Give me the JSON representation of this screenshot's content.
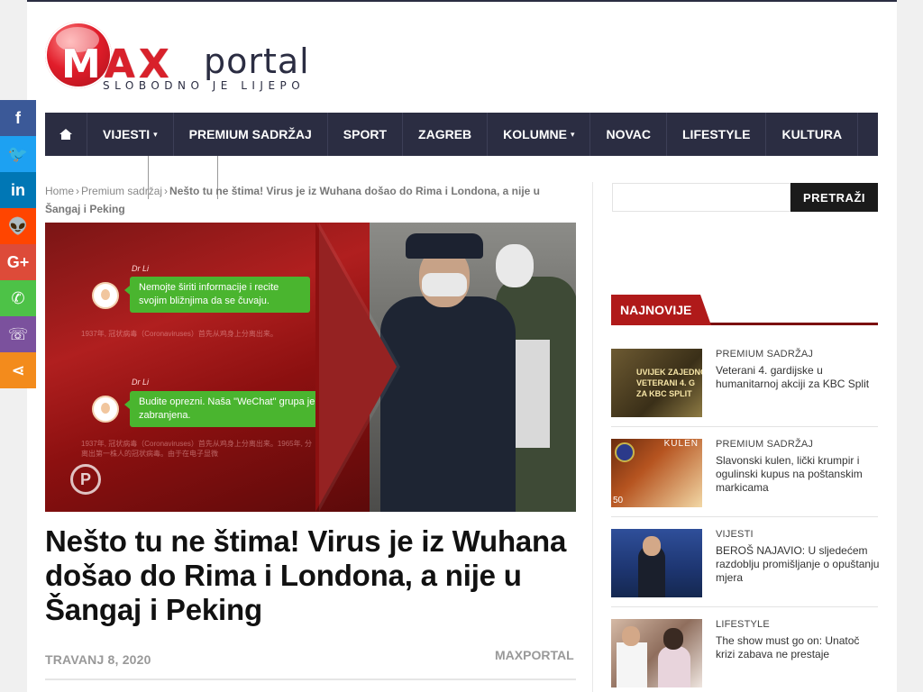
{
  "logo": {
    "max_first": "M",
    "max_rest": "AX",
    "portal": "portal",
    "slogan": "SLOBODNO JE LIJEPO"
  },
  "nav": {
    "items": [
      {
        "label": "VIJESTI",
        "dropdown": true
      },
      {
        "label": "PREMIUM SADRŽAJ",
        "dropdown": false
      },
      {
        "label": "SPORT",
        "dropdown": false
      },
      {
        "label": "ZAGREB",
        "dropdown": false
      },
      {
        "label": "KOLUMNE",
        "dropdown": true
      },
      {
        "label": "NOVAC",
        "dropdown": false
      },
      {
        "label": "LIFESTYLE",
        "dropdown": false
      },
      {
        "label": "KULTURA",
        "dropdown": false
      }
    ],
    "chevron": "▾"
  },
  "breadcrumb": {
    "home": "Home",
    "sep": "›",
    "category": "Premium sadržaj",
    "current": "Nešto tu ne štima! Virus je iz Wuhana došao do Rima i Londona, a nije u Šangaj i Peking"
  },
  "feature": {
    "chat_name_1": "Dr Li",
    "chat_name_2": "Dr Li",
    "bubble_1": "Nemojte širiti informacije i recite svojim bližnjima da se čuvaju.",
    "bubble_2": "Budite oprezni. Naša \"WeChat\" grupa je zabranjena.",
    "chat_bg_1": "1937年, 冠状病毒（Coronaviruses）首先从鸡身上分离出来。",
    "chat_bg_2": "1937年, 冠状病毒（Coronaviruses）首先从鸡身上分离出来。1965年, 分离出第一株人的冠状病毒。由于在电子显微",
    "watermark": "P"
  },
  "article": {
    "title": "Nešto tu ne štima! Virus je iz Wuhana došao do Rima i Londona, a nije u Šangaj i Peking",
    "date": "TRAVANJ 8, 2020",
    "author": "MAXPORTAL"
  },
  "sidebar": {
    "search_button": "PRETRAŽI",
    "search_placeholder": "",
    "section_title": "NAJNOVIJE",
    "posts": [
      {
        "category": "PREMIUM SADRŽAJ",
        "title": "Veterani 4. gardijske u humanitarnoj akciji za KBC Split",
        "thumb_text": "UVIJEK ZAJEDNO\nVETERANI 4. G\nZA KBC SPLIT"
      },
      {
        "category": "PREMIUM SADRŽAJ",
        "title": "Slavonski kulen, lički krumpir i ogulinski kupus na poštanskim markicama",
        "thumb_text": "KULEN",
        "thumb_num": "50"
      },
      {
        "category": "VIJESTI",
        "title": "BEROŠ NAJAVIO: U sljedećem razdoblju promišljanje o opuštanju mjera"
      },
      {
        "category": "LIFESTYLE",
        "title": "The show must go on: Unatoč krizi zabava ne prestaje"
      }
    ]
  },
  "social": [
    {
      "name": "facebook",
      "glyph": "f"
    },
    {
      "name": "twitter",
      "glyph": "🐦"
    },
    {
      "name": "linkedin",
      "glyph": "in"
    },
    {
      "name": "reddit",
      "glyph": "👽"
    },
    {
      "name": "google-plus",
      "glyph": "G+"
    },
    {
      "name": "whatsapp",
      "glyph": "✆"
    },
    {
      "name": "viber",
      "glyph": "☏"
    },
    {
      "name": "share",
      "glyph": "⋖"
    }
  ],
  "colors": {
    "nav_bg": "#2b2d42",
    "accent_red": "#b01a1a",
    "logo_red": "#d8212b"
  }
}
